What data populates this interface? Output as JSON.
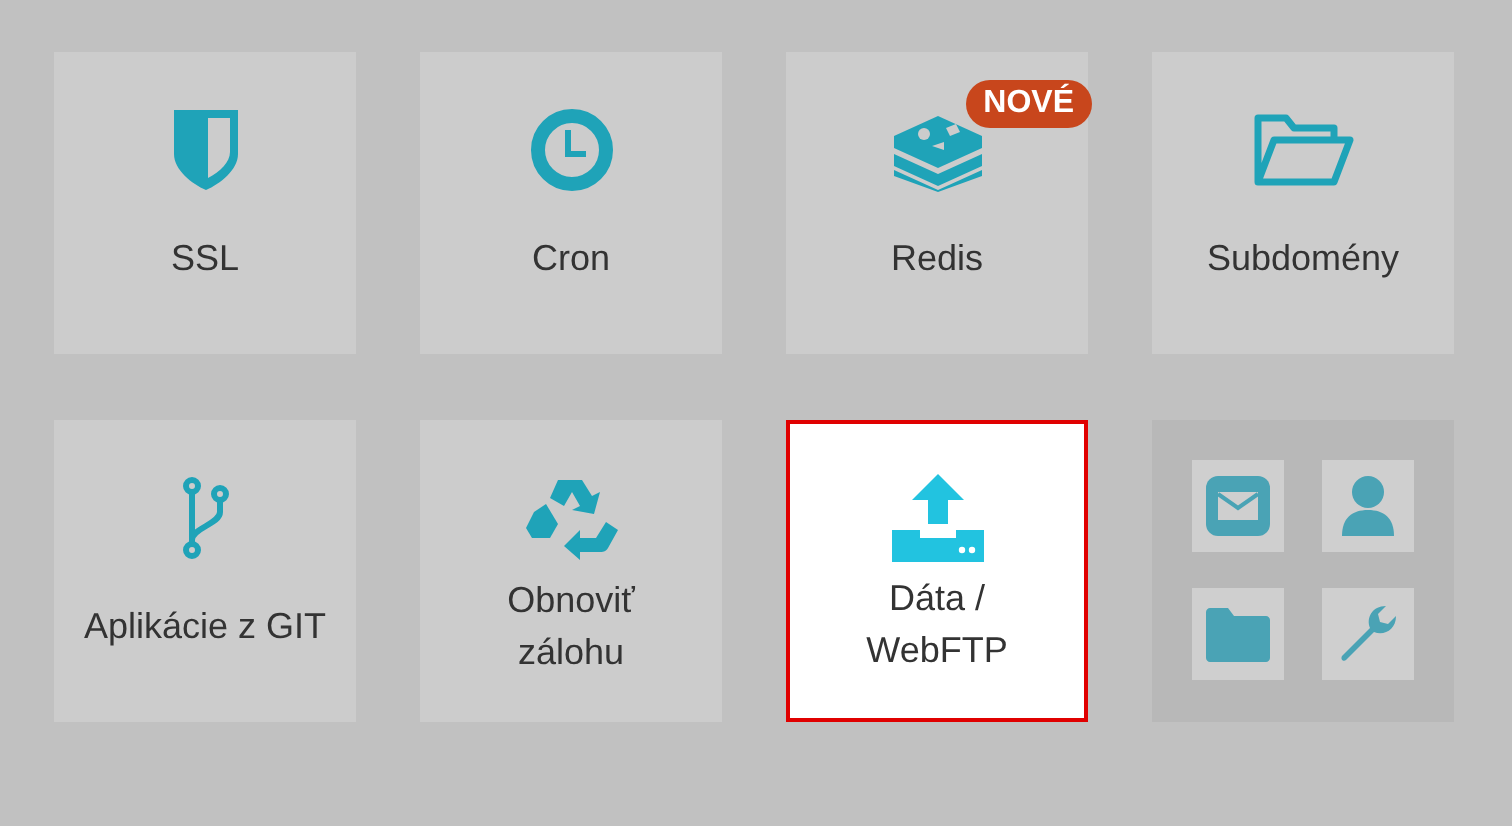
{
  "tiles": [
    {
      "kind": "app",
      "lines": [
        "SSL"
      ],
      "selected": false
    },
    {
      "kind": "app",
      "lines": [
        "Cron"
      ],
      "selected": false
    },
    {
      "kind": "app",
      "lines": [
        "Redis"
      ],
      "selected": false,
      "badge": "NOVÉ"
    },
    {
      "kind": "app",
      "lines": [
        "Subdomény"
      ],
      "selected": false
    },
    {
      "kind": "app",
      "lines": [
        "Aplikácie z GIT"
      ],
      "selected": false
    },
    {
      "kind": "app",
      "lines": [
        "Obnoviť",
        "zálohu"
      ],
      "selected": false
    },
    {
      "kind": "app",
      "lines": [
        "Dáta /",
        "WebFTP"
      ],
      "selected": true
    },
    {
      "kind": "shortcuts"
    }
  ]
}
